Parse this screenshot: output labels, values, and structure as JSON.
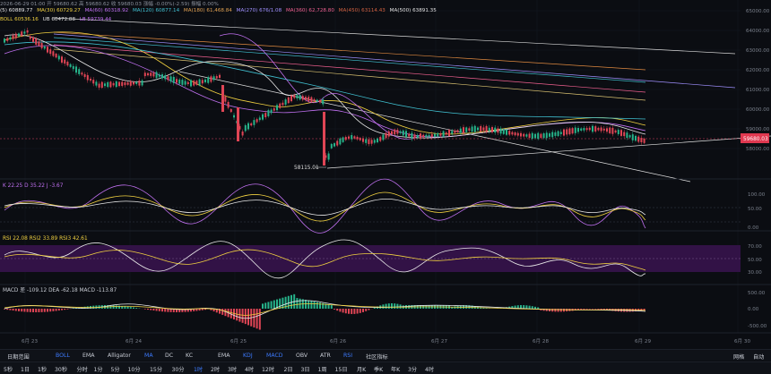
{
  "header": {
    "time_row": "2026-06-29 01:00  开 59680.62  高 59680.62  收 59680.03  涨幅 -0.00%(-2.59)  振幅 0.00%",
    "ma_items": [
      {
        "label": "(5) 60889.77",
        "color": "#e8e8e8"
      },
      {
        "label": "MA(30) 60729.27",
        "color": "#f0d040"
      },
      {
        "label": "MA(60) 60318.92",
        "color": "#c070f0"
      },
      {
        "label": "MA(120) 60877.14",
        "color": "#40c0d0"
      },
      {
        "label": "MA(180) 61,468.84",
        "color": "#e0a050"
      },
      {
        "label": "MA(270) 676/1.08",
        "color": "#a090ff"
      },
      {
        "label": "MA(360) 62,728.80",
        "color": "#f06090"
      },
      {
        "label": "MA(450) 63114.43",
        "color": "#d06040"
      },
      {
        "label": "MA(500) 63891.35",
        "color": "#e0e0e0"
      }
    ],
    "boll_items": [
      {
        "label": "BOLL 60536.16",
        "color": "#f0d040"
      },
      {
        "label": "UB 60472.88",
        "color": "#e0e0e0"
      },
      {
        "label": "LB 59739.44",
        "color": "#c070f0"
      }
    ]
  },
  "price_axis": [
    "65000.00",
    "64000.00",
    "63000.00",
    "62000.00",
    "61000.00",
    "60000.00",
    "59000.00",
    "58000.00"
  ],
  "current_price": "59680.03",
  "low_label": "58115.01",
  "panels": {
    "kdj": {
      "label": "K 22.25  D 35.22  J -3.67",
      "axis": [
        "100.00",
        "50.00",
        "0.00"
      ]
    },
    "rsi": {
      "label": "RSI 22.08  RSI2 33.89  RSI3 42.61",
      "axis": [
        "70.00",
        "50.00",
        "30.00"
      ]
    },
    "macd": {
      "label": "MACD 差 -109.12  DEA -62.18  MACD -113.87",
      "axis": [
        "500.00",
        "0.00",
        "-500.00"
      ]
    }
  },
  "dates": [
    "6月 23",
    "6月 24",
    "6月 25",
    "6月 26",
    "6月 27",
    "6月 28",
    "6月 29",
    "6月 30"
  ],
  "toolbar_top": {
    "left_label": "日期范围",
    "indicators": [
      "BOLL",
      "EMA",
      "Alligator",
      "MA",
      "DC",
      "KC",
      "EMA",
      "KDJ",
      "MACD",
      "OBV",
      "ATR",
      "RSI",
      "社区指标"
    ],
    "active": [
      "BOLL",
      "MA",
      "KDJ",
      "MACD",
      "RSI"
    ],
    "right": [
      "网格",
      "自动"
    ]
  },
  "toolbar_bottom": {
    "items": [
      "5秒",
      "1日",
      "1秒",
      "30秒",
      "分时",
      "1分",
      "5分",
      "10分",
      "15分",
      "30分",
      "1时",
      "2时",
      "3时",
      "4时",
      "12时",
      "2日",
      "3日",
      "1周",
      "15日",
      "月K",
      "季K",
      "年K",
      "3分",
      "4时"
    ],
    "active": "1时"
  }
}
